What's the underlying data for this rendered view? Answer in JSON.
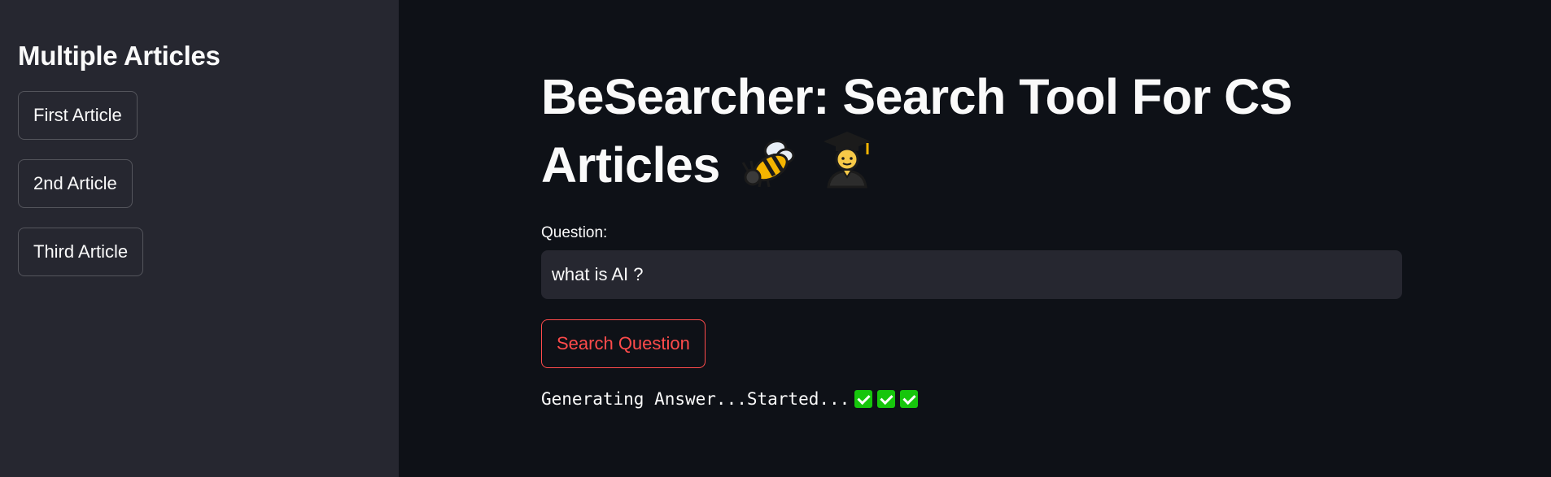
{
  "sidebar": {
    "title": "Multiple Articles",
    "buttons": [
      {
        "label": "First Article"
      },
      {
        "label": "2nd Article"
      },
      {
        "label": "Third Article"
      }
    ]
  },
  "main": {
    "title_line1": "BeSearcher: Search Tool For CS",
    "title_line2": "Articles",
    "title_icons": [
      "bee-icon",
      "student-icon"
    ],
    "question_label": "Question:",
    "question_value": "what is AI ?",
    "search_button": "Search Question",
    "status_text": "Generating Answer...Started...",
    "status_icons": [
      "check-mark-icon",
      "check-mark-icon",
      "check-mark-icon"
    ]
  },
  "colors": {
    "sidebar_bg": "#262730",
    "main_bg": "#0e1117",
    "accent": "#ff4b4b",
    "check_green": "#16c60c"
  }
}
